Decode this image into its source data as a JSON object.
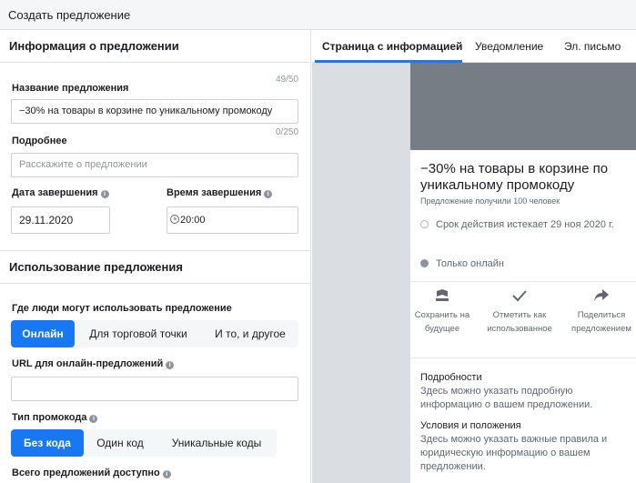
{
  "window": {
    "title": "Создать предложение"
  },
  "left": {
    "info_section": {
      "title": "Информация о предложении",
      "name_label": "Название предложения",
      "name_count": "49/50",
      "name_value": "−30% на товары в корзине по уникальному промокоду",
      "details_label": "Подробнее",
      "details_count": "0/250",
      "details_placeholder": "Расскажите о предложении",
      "end_date_label": "Дата завершения",
      "end_date_value": "29.11.2020",
      "end_time_label": "Время завершения",
      "end_time_value": "20:00"
    },
    "usage_section": {
      "title": "Использование предложения",
      "where_label": "Где люди могут использовать предложение",
      "where_options": [
        "Онлайн",
        "Для торговой точки",
        "И то, и другое"
      ],
      "where_selected": "Онлайн",
      "url_label": "URL для онлайн-предложений",
      "url_value": "",
      "promo_type_label": "Тип промокода",
      "promo_options": [
        "Без кода",
        "Один код",
        "Уникальные коды"
      ],
      "promo_selected": "Без кода",
      "total_label": "Всего предложений доступно"
    }
  },
  "preview": {
    "tabs": [
      "Страница с информацией",
      "Уведомление",
      "Эл. письмо"
    ],
    "active_tab": "Страница с информацией",
    "offer_title": "−30% на товары в корзине по уникальному промокоду",
    "received": "Предложение получили 100 человек",
    "expiry": "Срок действия истекает 29 ноя 2020 г.",
    "availability": "Только онлайн",
    "actions": [
      {
        "label": "Сохранить на будущее",
        "icon": "save-bookmark-icon"
      },
      {
        "label": "Отметить как использованное",
        "icon": "checkmark-icon"
      },
      {
        "label": "Поделиться предложением",
        "icon": "share-icon"
      }
    ],
    "details_heading": "Подробности",
    "details_text": "Здесь можно указать подробную информацию о вашем предложении.",
    "terms_heading": "Условия и положения",
    "terms_text": "Здесь можно указать важные правила и юридическую информацию о вашем предложении."
  },
  "colors": {
    "accent": "#1877f2",
    "preview_background": "#dadde1",
    "cover": "#777d85"
  }
}
